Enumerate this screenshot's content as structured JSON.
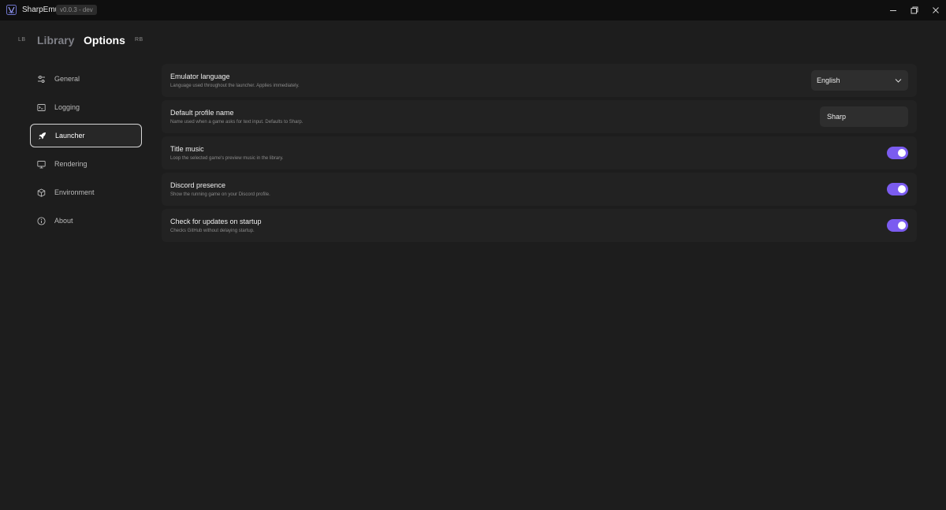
{
  "app": {
    "name": "SharpEmu",
    "version": "v0.0.3 - dev",
    "accent_color": "#7b5cf0"
  },
  "window_controls": [
    {
      "name": "minimize-button",
      "icon": "minimize-icon"
    },
    {
      "name": "maximize-button",
      "icon": "maximize-icon"
    },
    {
      "name": "close-button",
      "icon": "close-icon"
    }
  ],
  "topnav": {
    "left_shoulder": "LB",
    "right_shoulder": "RB",
    "tabs": [
      {
        "label": "Library",
        "active": false
      },
      {
        "label": "Options",
        "active": true
      }
    ]
  },
  "sidebar": {
    "items": [
      {
        "label": "General",
        "icon": "sliders-icon",
        "active": false
      },
      {
        "label": "Logging",
        "icon": "terminal-icon",
        "active": false
      },
      {
        "label": "Launcher",
        "icon": "rocket-icon",
        "active": true
      },
      {
        "label": "Rendering",
        "icon": "monitor-icon",
        "active": false
      },
      {
        "label": "Environment",
        "icon": "cube-icon",
        "active": false
      },
      {
        "label": "About",
        "icon": "info-icon",
        "active": false
      }
    ]
  },
  "settings": {
    "language": {
      "title": "Emulator language",
      "description": "Language used throughout the launcher. Applies immediately.",
      "value": "English"
    },
    "profile_name": {
      "title": "Default profile name",
      "description": "Name used when a game asks for text input. Defaults to Sharp.",
      "value": "Sharp"
    },
    "title_music": {
      "title": "Title music",
      "description": "Loop the selected game's preview music in the library.",
      "enabled": true
    },
    "discord": {
      "title": "Discord presence",
      "description": "Show the running game on your Discord profile.",
      "enabled": true
    },
    "updates": {
      "title": "Check for updates on startup",
      "description": "Checks GitHub without delaying startup.",
      "enabled": true
    }
  }
}
